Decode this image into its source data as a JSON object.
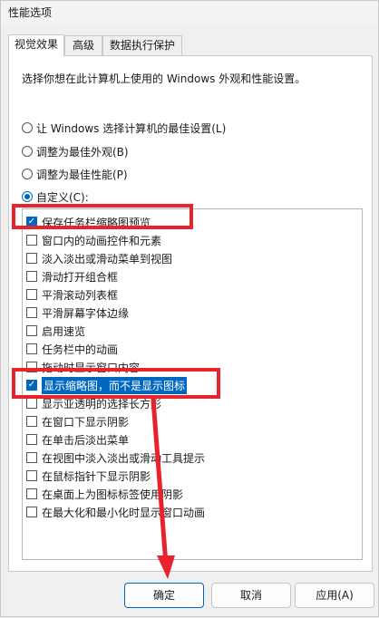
{
  "window": {
    "title": "性能选项"
  },
  "tabs": [
    {
      "label": "视觉效果"
    },
    {
      "label": "高级"
    },
    {
      "label": "数据执行保护"
    }
  ],
  "intro": "选择你想在此计算机上使用的 Windows 外观和性能设置。",
  "radios": [
    {
      "label": "让 Windows 选择计算机的最佳设置(L)",
      "checked": false
    },
    {
      "label": "调整为最佳外观(B)",
      "checked": false
    },
    {
      "label": "调整为最佳性能(P)",
      "checked": false
    },
    {
      "label": "自定义(C):",
      "checked": true
    }
  ],
  "items": [
    {
      "label": "保存任务栏缩略图预览",
      "checked": true
    },
    {
      "label": "窗口内的动画控件和元素",
      "checked": false
    },
    {
      "label": "淡入淡出或滑动菜单到视图",
      "checked": false
    },
    {
      "label": "滑动打开组合框",
      "checked": false
    },
    {
      "label": "平滑滚动列表框",
      "checked": false
    },
    {
      "label": "平滑屏幕字体边缘",
      "checked": false
    },
    {
      "label": "启用速览",
      "checked": false
    },
    {
      "label": "任务栏中的动画",
      "checked": false
    },
    {
      "label": "拖动时显示窗口内容",
      "checked": false
    },
    {
      "label": "显示缩略图，而不是显示图标",
      "checked": true,
      "selected": true
    },
    {
      "label": "显示亚透明的选择长方形",
      "checked": false
    },
    {
      "label": "在窗口下显示阴影",
      "checked": false
    },
    {
      "label": "在单击后淡出菜单",
      "checked": false
    },
    {
      "label": "在视图中淡入淡出或滑动工具提示",
      "checked": false
    },
    {
      "label": "在鼠标指针下显示阴影",
      "checked": false
    },
    {
      "label": "在桌面上为图标标签使用阴影",
      "checked": false
    },
    {
      "label": "在最大化和最小化时显示窗口动画",
      "checked": false
    }
  ],
  "buttons": {
    "ok": "确定",
    "cancel": "取消",
    "apply": "应用(A)"
  },
  "colors": {
    "accent": "#0067c0",
    "annotation": "#e8232b"
  }
}
